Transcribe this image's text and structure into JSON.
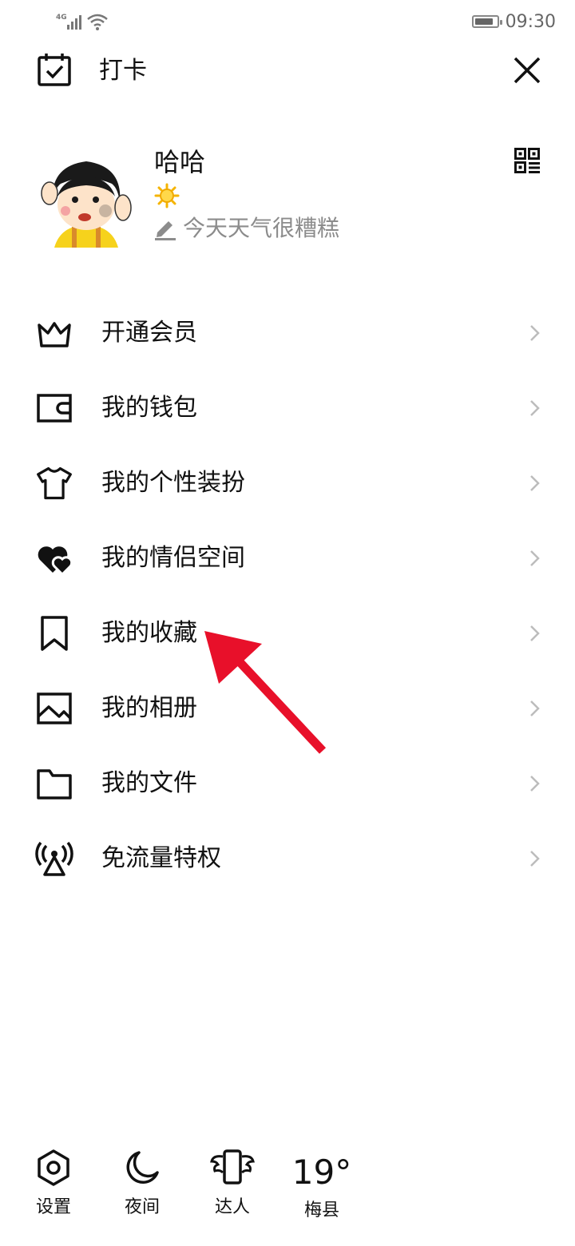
{
  "status": {
    "network": "4G",
    "time": "09:30",
    "battery_level": 0.85
  },
  "header": {
    "checkin_label": "打卡"
  },
  "profile": {
    "nickname": "哈哈",
    "signature": "今天天气很糟糕"
  },
  "menu": {
    "items": [
      {
        "label": "开通会员",
        "icon": "crown-icon"
      },
      {
        "label": "我的钱包",
        "icon": "wallet-icon"
      },
      {
        "label": "我的个性装扮",
        "icon": "shirt-icon"
      },
      {
        "label": "我的情侣空间",
        "icon": "hearts-icon"
      },
      {
        "label": "我的收藏",
        "icon": "bookmark-icon"
      },
      {
        "label": "我的相册",
        "icon": "image-icon"
      },
      {
        "label": "我的文件",
        "icon": "folder-icon"
      },
      {
        "label": "免流量特权",
        "icon": "signal-tower-icon"
      }
    ]
  },
  "toolbar": {
    "settings_label": "设置",
    "night_label": "夜间",
    "expert_label": "达人",
    "temperature": "19°",
    "location": "梅县"
  },
  "colors": {
    "text": "#111111",
    "muted": "#8c8c8c",
    "chevron": "#bcbcbc",
    "annotation_arrow": "#e8102a",
    "level_sun": "#f5b400"
  }
}
